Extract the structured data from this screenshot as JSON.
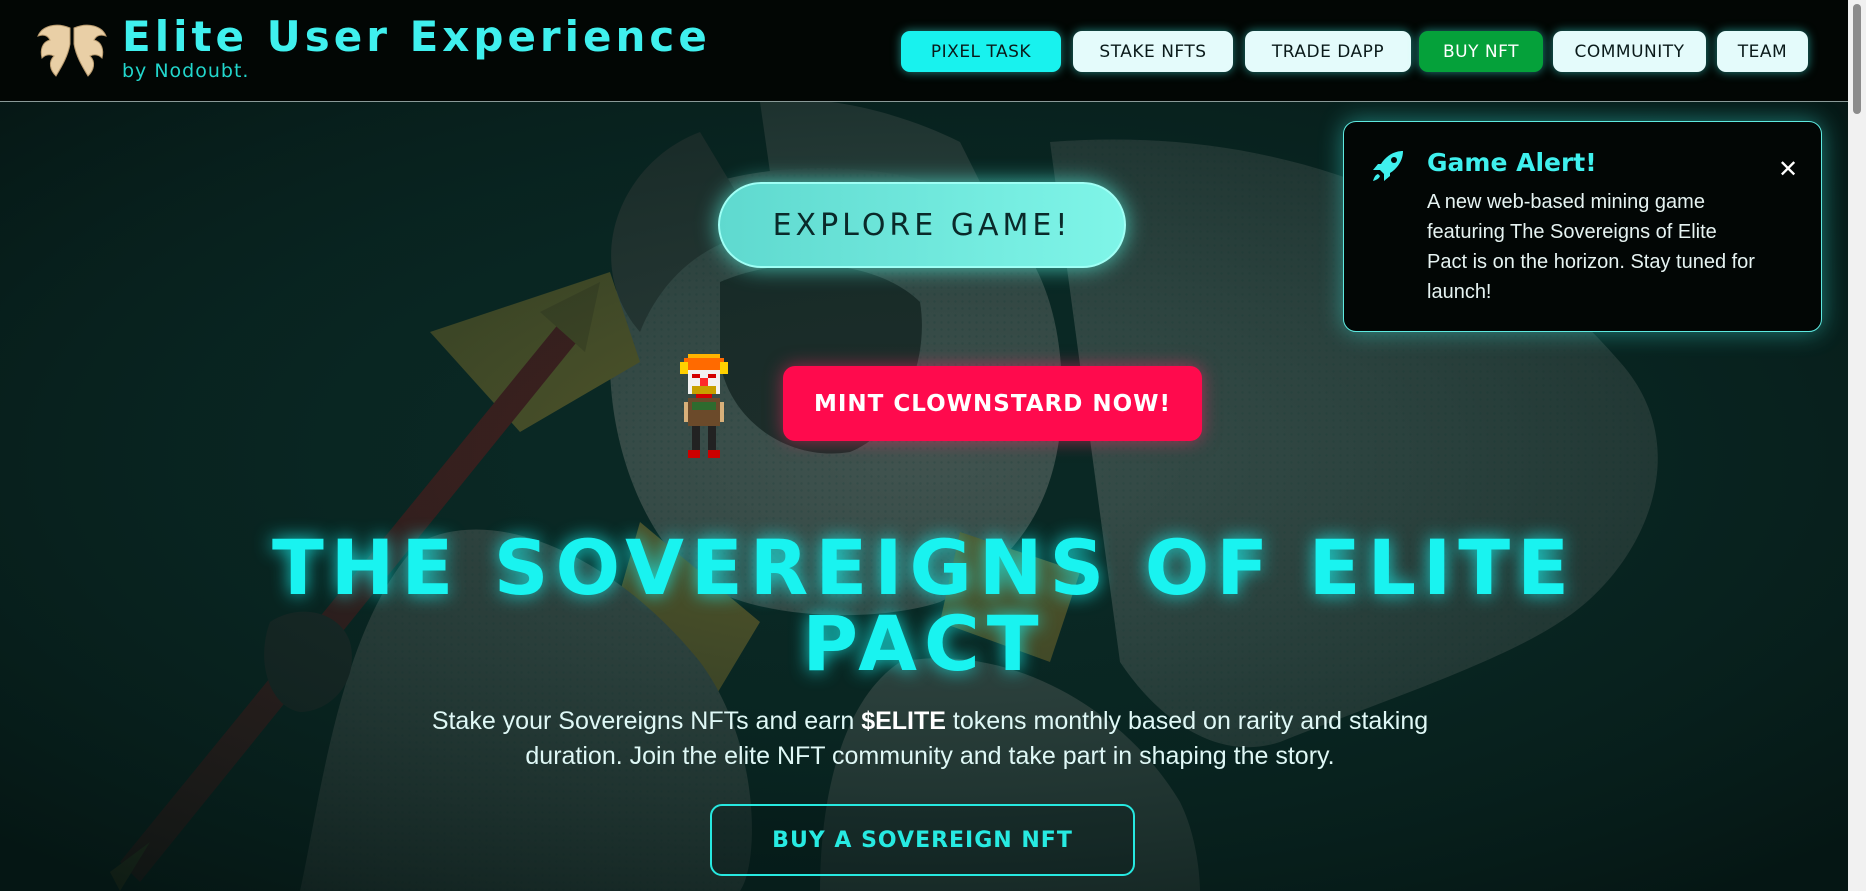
{
  "header": {
    "brand_title": "Elite User Experience",
    "brand_subtitle": "by Nodoubt.",
    "logo_icon": "angel-wings-logo",
    "nav": [
      {
        "label": "PIXEL TASK",
        "state": "active"
      },
      {
        "label": "STAKE NFTS",
        "state": "default"
      },
      {
        "label": "TRADE DAPP",
        "state": "default"
      },
      {
        "label": "BUY NFT",
        "state": "highlight"
      },
      {
        "label": "COMMUNITY",
        "state": "default"
      },
      {
        "label": "TEAM",
        "state": "default"
      }
    ]
  },
  "hero": {
    "explore_label": "EXPLORE GAME!",
    "mint_label": "MINT CLOWNSTARD NOW!",
    "mint_icon": "clown-pixel-sprite",
    "title_line1": "THE SOVEREIGNS OF ELITE",
    "title_line2": "PACT",
    "description_before": "Stake your Sovereigns NFTs and earn ",
    "description_highlight": "$ELITE",
    "description_after": " tokens monthly based on rarity and staking duration. Join the elite NFT community and take part in shaping the story.",
    "buy_label": "BUY A SOVEREIGN NFT"
  },
  "alert": {
    "icon": "rocket-icon",
    "title": "Game Alert!",
    "body": "A new web-based mining game featuring The Sovereigns of Elite Pact is on the horizon. Stay tuned for launch!",
    "close_icon": "close-icon",
    "close_glyph": "✕"
  },
  "colors": {
    "accent": "#19f3f0",
    "mint": "#ff0a4d",
    "buy_nav": "#05a13a",
    "background": "#082420"
  }
}
